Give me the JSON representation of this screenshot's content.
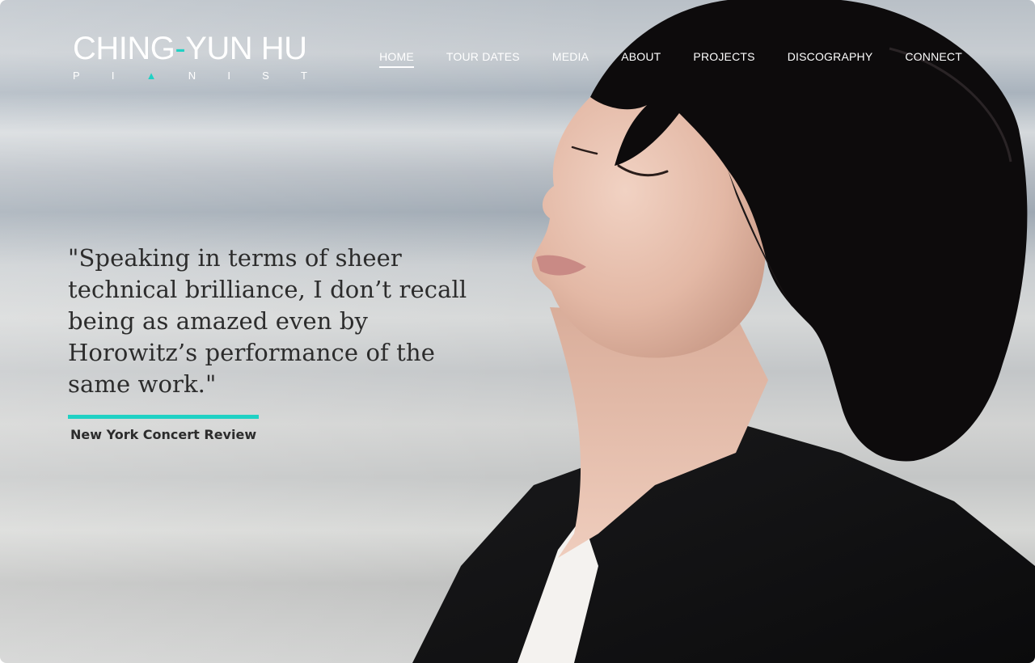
{
  "brand": {
    "name_part1": "CHING",
    "name_dash": "-",
    "name_part2": "YUN HU",
    "subtitle_letters": [
      "P",
      "I",
      "▲",
      "N",
      "I",
      "S",
      "T"
    ],
    "accent_color": "#1fd1c4"
  },
  "nav": {
    "items": [
      {
        "label": "HOME",
        "active": true
      },
      {
        "label": "TOUR DATES",
        "active": false
      },
      {
        "label": "MEDIA",
        "active": false
      },
      {
        "label": "ABOUT",
        "active": false
      },
      {
        "label": "PROJECTS",
        "active": false
      },
      {
        "label": "DISCOGRAPHY",
        "active": false
      },
      {
        "label": "CONNECT",
        "active": false
      }
    ]
  },
  "hero": {
    "quote": "\"Speaking in terms of sheer technical brilliance, I don’t recall being as amazed even by Horowitz’s performance of the same work.\"",
    "source": "New York Concert Review",
    "image": "portrait-photo"
  }
}
